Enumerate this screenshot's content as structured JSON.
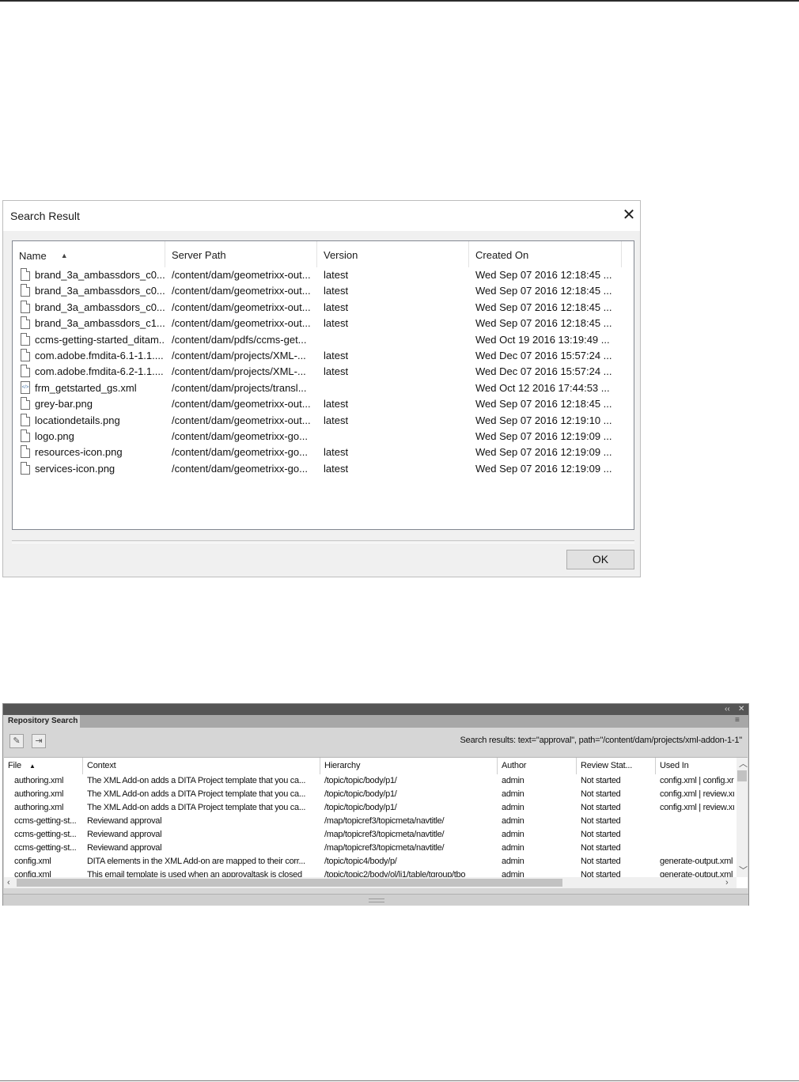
{
  "search_result": {
    "title": "Search Result",
    "close_icon": "close-icon",
    "columns": [
      "Name",
      "Server Path",
      "Version",
      "Created On"
    ],
    "sort_column": "Name",
    "rows": [
      {
        "icon": "file-icon",
        "name": "brand_3a_ambassdors_c0...",
        "path": "/content/dam/geometrixx-out...",
        "version": "latest",
        "created": "Wed Sep 07 2016 12:18:45 ..."
      },
      {
        "icon": "file-icon",
        "name": "brand_3a_ambassdors_c0...",
        "path": "/content/dam/geometrixx-out...",
        "version": "latest",
        "created": "Wed Sep 07 2016 12:18:45 ..."
      },
      {
        "icon": "file-icon",
        "name": "brand_3a_ambassdors_c0...",
        "path": "/content/dam/geometrixx-out...",
        "version": "latest",
        "created": "Wed Sep 07 2016 12:18:45 ..."
      },
      {
        "icon": "file-icon",
        "name": "brand_3a_ambassdors_c1...",
        "path": "/content/dam/geometrixx-out...",
        "version": "latest",
        "created": "Wed Sep 07 2016 12:18:45 ..."
      },
      {
        "icon": "file-icon",
        "name": "ccms-getting-started_ditam...",
        "path": "/content/dam/pdfs/ccms-get...",
        "version": "",
        "created": "Wed Oct 19 2016 13:19:49 ..."
      },
      {
        "icon": "file-icon",
        "name": "com.adobe.fmdita-6.1-1.1....",
        "path": "/content/dam/projects/XML-...",
        "version": "latest",
        "created": "Wed Dec 07 2016 15:57:24 ..."
      },
      {
        "icon": "file-icon",
        "name": "com.adobe.fmdita-6.2-1.1....",
        "path": "/content/dam/projects/XML-...",
        "version": "latest",
        "created": "Wed Dec 07 2016 15:57:24 ..."
      },
      {
        "icon": "xml-file-icon",
        "name": "frm_getstarted_gs.xml",
        "path": "/content/dam/projects/transl...",
        "version": "",
        "created": "Wed Oct 12 2016 17:44:53 ..."
      },
      {
        "icon": "file-icon",
        "name": "grey-bar.png",
        "path": "/content/dam/geometrixx-out...",
        "version": "latest",
        "created": "Wed Sep 07 2016 12:18:45 ..."
      },
      {
        "icon": "file-icon",
        "name": "locationdetails.png",
        "path": "/content/dam/geometrixx-out...",
        "version": "latest",
        "created": "Wed Sep 07 2016 12:19:10 ..."
      },
      {
        "icon": "file-icon",
        "name": "logo.png",
        "path": "/content/dam/geometrixx-go...",
        "version": "",
        "created": "Wed Sep 07 2016 12:19:09 ..."
      },
      {
        "icon": "file-icon",
        "name": "resources-icon.png",
        "path": "/content/dam/geometrixx-go...",
        "version": "latest",
        "created": "Wed Sep 07 2016 12:19:09 ..."
      },
      {
        "icon": "file-icon",
        "name": "services-icon.png",
        "path": "/content/dam/geometrixx-go...",
        "version": "latest",
        "created": "Wed Sep 07 2016 12:19:09 ..."
      }
    ],
    "ok_label": "OK"
  },
  "repository_search": {
    "tab_label": "Repository Search",
    "top_controls": [
      "‹‹",
      "✕"
    ],
    "toolbar_icons": [
      "edit-icon",
      "insert-icon"
    ],
    "status": "Search results: text=\"approval\", path=\"/content/dam/projects/xml-addon-1-1\"",
    "columns": [
      "File",
      "Context",
      "Hierarchy",
      "Author",
      "Review Stat...",
      "Used In"
    ],
    "sort_column": "File",
    "rows": [
      {
        "file": "authoring.xml",
        "context": "The XML Add-on adds a DITA Project template that you ca...",
        "hierarchy": "/topic/topic/body/p1/",
        "author": "admin",
        "review": "Not started",
        "used_in": "config.xml | config.xr"
      },
      {
        "file": "authoring.xml",
        "context": "The XML Add-on adds a DITA Project template that you ca...",
        "hierarchy": "/topic/topic/body/p1/",
        "author": "admin",
        "review": "Not started",
        "used_in": "config.xml | review.xı"
      },
      {
        "file": "authoring.xml",
        "context": "The XML Add-on adds a DITA Project template that you ca...",
        "hierarchy": "/topic/topic/body/p1/",
        "author": "admin",
        "review": "Not started",
        "used_in": "config.xml | review.xı"
      },
      {
        "file": "ccms-getting-st...",
        "context": "Reviewand approval",
        "hierarchy": "/map/topicref3/topicmeta/navtitle/",
        "author": "admin",
        "review": "Not started",
        "used_in": ""
      },
      {
        "file": "ccms-getting-st...",
        "context": "Reviewand approval",
        "hierarchy": "/map/topicref3/topicmeta/navtitle/",
        "author": "admin",
        "review": "Not started",
        "used_in": ""
      },
      {
        "file": "ccms-getting-st...",
        "context": "Reviewand approval",
        "hierarchy": "/map/topicref3/topicmeta/navtitle/",
        "author": "admin",
        "review": "Not started",
        "used_in": ""
      },
      {
        "file": "config.xml",
        "context": "DITA elements in the XML Add-on are mapped to their corr...",
        "hierarchy": "/topic/topic4/body/p/",
        "author": "admin",
        "review": "Not started",
        "used_in": "generate-output.xml"
      },
      {
        "file": "config.xml",
        "context": "This email template is used when an approvaltask is closed",
        "hierarchy": "/topic/topic2/body/ol/li1/table/tgroup/tbo",
        "author": "admin",
        "review": "Not started",
        "used_in": "generate-output.xml"
      }
    ]
  }
}
